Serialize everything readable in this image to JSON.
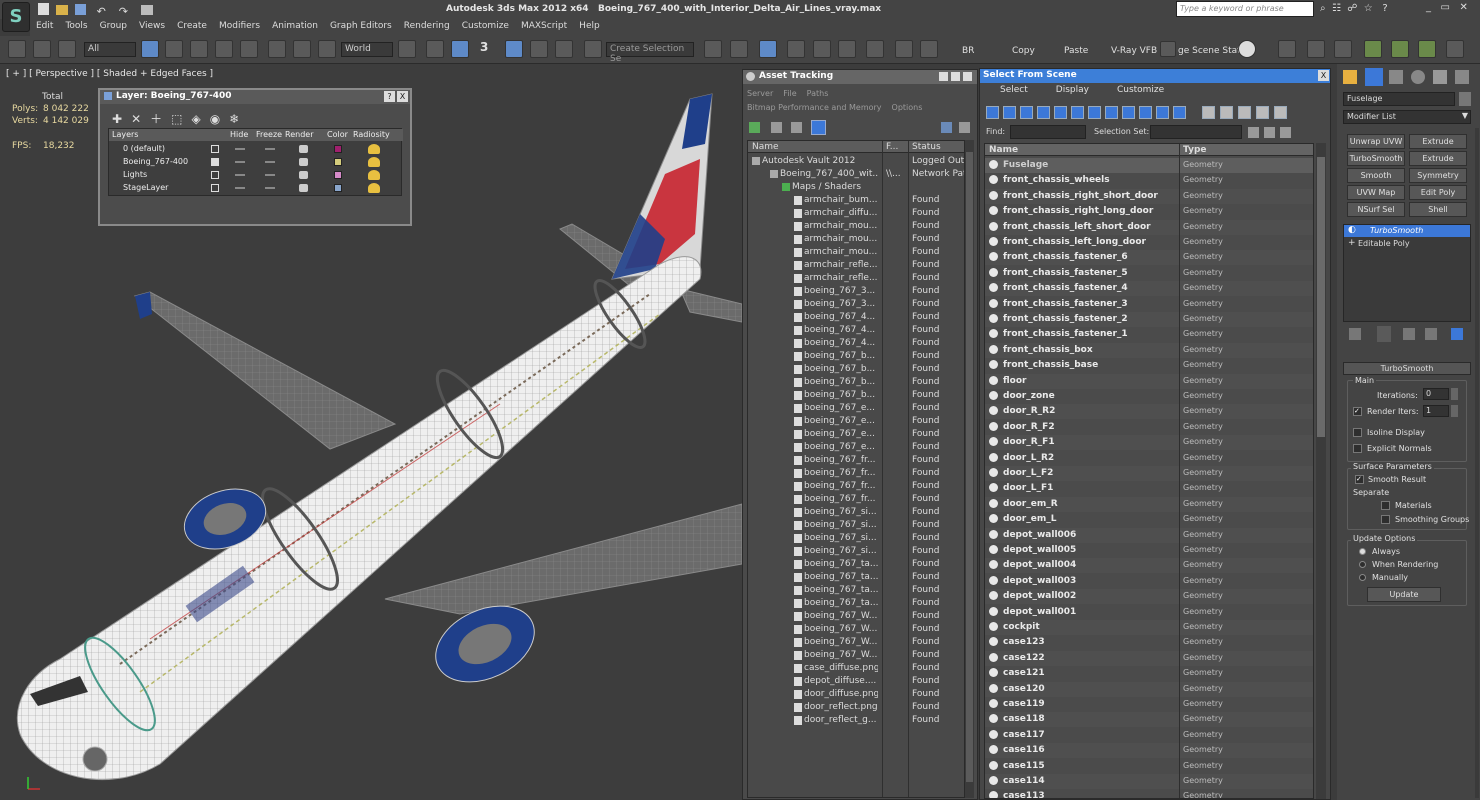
{
  "window": {
    "app_title": "Autodesk 3ds Max  2012 x64",
    "file_title": "Boeing_767_400_with_Interior_Delta_Air_Lines_vray.max",
    "search_placeholder": "Type a keyword or phrase",
    "app_icon_letter": "S"
  },
  "menu": [
    "Edit",
    "Tools",
    "Group",
    "Views",
    "Create",
    "Modifiers",
    "Animation",
    "Graph Editors",
    "Rendering",
    "Customize",
    "MAXScript",
    "Help"
  ],
  "toolbar": {
    "filter": "All",
    "coord": "World",
    "snap_num": "3",
    "selection_set_placeholder": "Create Selection Se",
    "render_buttons": [
      "BR",
      "Copy",
      "Paste",
      "V-Ray VFB",
      "ge Scene Stat"
    ]
  },
  "viewport": {
    "label": "[ + ] [ Perspective ] [ Shaded + Edged Faces ]",
    "stats": {
      "total_label": "Total",
      "polys_label": "Polys:",
      "polys": "8 042 222",
      "verts_label": "Verts:",
      "verts": "4 142 029",
      "fps_label": "FPS:",
      "fps": "18,232"
    }
  },
  "layer_dialog": {
    "title": "Layer: Boeing_767-400",
    "help": "?",
    "close": "X",
    "columns": [
      "Layers",
      "Hide",
      "Freeze",
      "Render",
      "Color",
      "Radiosity"
    ],
    "rows": [
      {
        "name": "0 (default)",
        "color": "#a0206e"
      },
      {
        "name": "Boeing_767-400",
        "color": "#d4cc7c"
      },
      {
        "name": "Lights",
        "color": "#d58ac8"
      },
      {
        "name": "StageLayer",
        "color": "#8aa6cc"
      }
    ]
  },
  "asset_tracking": {
    "title": "Asset Tracking",
    "menu": [
      "Server",
      "File",
      "Paths",
      "Bitmap Performance and Memory",
      "Options"
    ],
    "columns": [
      "Name",
      "F...",
      "Status"
    ],
    "rows": [
      {
        "name": "Autodesk Vault 2012",
        "f": "",
        "status": "Logged Out (..."
      },
      {
        "name": "Boeing_767_400_wit...",
        "f": "\\\\...",
        "status": "Network Path"
      },
      {
        "name": "Maps / Shaders",
        "f": "",
        "status": ""
      },
      {
        "name": "armchair_bum...",
        "f": "",
        "status": "Found"
      },
      {
        "name": "armchair_diffu...",
        "f": "",
        "status": "Found"
      },
      {
        "name": "armchair_mou...",
        "f": "",
        "status": "Found"
      },
      {
        "name": "armchair_mou...",
        "f": "",
        "status": "Found"
      },
      {
        "name": "armchair_mou...",
        "f": "",
        "status": "Found"
      },
      {
        "name": "armchair_refle...",
        "f": "",
        "status": "Found"
      },
      {
        "name": "armchair_refle...",
        "f": "",
        "status": "Found"
      },
      {
        "name": "boeing_767_3...",
        "f": "",
        "status": "Found"
      },
      {
        "name": "boeing_767_3...",
        "f": "",
        "status": "Found"
      },
      {
        "name": "boeing_767_4...",
        "f": "",
        "status": "Found"
      },
      {
        "name": "boeing_767_4...",
        "f": "",
        "status": "Found"
      },
      {
        "name": "boeing_767_4...",
        "f": "",
        "status": "Found"
      },
      {
        "name": "boeing_767_b...",
        "f": "",
        "status": "Found"
      },
      {
        "name": "boeing_767_b...",
        "f": "",
        "status": "Found"
      },
      {
        "name": "boeing_767_b...",
        "f": "",
        "status": "Found"
      },
      {
        "name": "boeing_767_b...",
        "f": "",
        "status": "Found"
      },
      {
        "name": "boeing_767_e...",
        "f": "",
        "status": "Found"
      },
      {
        "name": "boeing_767_e...",
        "f": "",
        "status": "Found"
      },
      {
        "name": "boeing_767_e...",
        "f": "",
        "status": "Found"
      },
      {
        "name": "boeing_767_e...",
        "f": "",
        "status": "Found"
      },
      {
        "name": "boeing_767_fr...",
        "f": "",
        "status": "Found"
      },
      {
        "name": "boeing_767_fr...",
        "f": "",
        "status": "Found"
      },
      {
        "name": "boeing_767_fr...",
        "f": "",
        "status": "Found"
      },
      {
        "name": "boeing_767_fr...",
        "f": "",
        "status": "Found"
      },
      {
        "name": "boeing_767_si...",
        "f": "",
        "status": "Found"
      },
      {
        "name": "boeing_767_si...",
        "f": "",
        "status": "Found"
      },
      {
        "name": "boeing_767_si...",
        "f": "",
        "status": "Found"
      },
      {
        "name": "boeing_767_si...",
        "f": "",
        "status": "Found"
      },
      {
        "name": "boeing_767_ta...",
        "f": "",
        "status": "Found"
      },
      {
        "name": "boeing_767_ta...",
        "f": "",
        "status": "Found"
      },
      {
        "name": "boeing_767_ta...",
        "f": "",
        "status": "Found"
      },
      {
        "name": "boeing_767_ta...",
        "f": "",
        "status": "Found"
      },
      {
        "name": "boeing_767_W...",
        "f": "",
        "status": "Found"
      },
      {
        "name": "boeing_767_W...",
        "f": "",
        "status": "Found"
      },
      {
        "name": "boeing_767_W...",
        "f": "",
        "status": "Found"
      },
      {
        "name": "boeing_767_W...",
        "f": "",
        "status": "Found"
      },
      {
        "name": "case_diffuse.png",
        "f": "",
        "status": "Found"
      },
      {
        "name": "depot_diffuse....",
        "f": "",
        "status": "Found"
      },
      {
        "name": "door_diffuse.png",
        "f": "",
        "status": "Found"
      },
      {
        "name": "door_reflect.png",
        "f": "",
        "status": "Found"
      },
      {
        "name": "door_reflect_g...",
        "f": "",
        "status": "Found"
      }
    ]
  },
  "select_from_scene": {
    "title": "Select From Scene",
    "close": "X",
    "menu": [
      "Select",
      "Display",
      "Customize"
    ],
    "find_label": "Find:",
    "selection_set_label": "Selection Set:",
    "columns": [
      "Name",
      "Type"
    ],
    "rows": [
      {
        "name": "Fuselage",
        "type": "Geometry",
        "selected": true
      },
      {
        "name": "front_chassis_wheels",
        "type": "Geometry"
      },
      {
        "name": "front_chassis_right_short_door",
        "type": "Geometry"
      },
      {
        "name": "front_chassis_right_long_door",
        "type": "Geometry"
      },
      {
        "name": "front_chassis_left_short_door",
        "type": "Geometry"
      },
      {
        "name": "front_chassis_left_long_door",
        "type": "Geometry"
      },
      {
        "name": "front_chassis_fastener_6",
        "type": "Geometry"
      },
      {
        "name": "front_chassis_fastener_5",
        "type": "Geometry"
      },
      {
        "name": "front_chassis_fastener_4",
        "type": "Geometry"
      },
      {
        "name": "front_chassis_fastener_3",
        "type": "Geometry"
      },
      {
        "name": "front_chassis_fastener_2",
        "type": "Geometry"
      },
      {
        "name": "front_chassis_fastener_1",
        "type": "Geometry"
      },
      {
        "name": "front_chassis_box",
        "type": "Geometry"
      },
      {
        "name": "front_chassis_base",
        "type": "Geometry"
      },
      {
        "name": "floor",
        "type": "Geometry"
      },
      {
        "name": "door_zone",
        "type": "Geometry"
      },
      {
        "name": "door_R_R2",
        "type": "Geometry"
      },
      {
        "name": "door_R_F2",
        "type": "Geometry"
      },
      {
        "name": "door_R_F1",
        "type": "Geometry"
      },
      {
        "name": "door_L_R2",
        "type": "Geometry"
      },
      {
        "name": "door_L_F2",
        "type": "Geometry"
      },
      {
        "name": "door_L_F1",
        "type": "Geometry"
      },
      {
        "name": "door_em_R",
        "type": "Geometry"
      },
      {
        "name": "door_em_L",
        "type": "Geometry"
      },
      {
        "name": "depot_wall006",
        "type": "Geometry"
      },
      {
        "name": "depot_wall005",
        "type": "Geometry"
      },
      {
        "name": "depot_wall004",
        "type": "Geometry"
      },
      {
        "name": "depot_wall003",
        "type": "Geometry"
      },
      {
        "name": "depot_wall002",
        "type": "Geometry"
      },
      {
        "name": "depot_wall001",
        "type": "Geometry"
      },
      {
        "name": "cockpit",
        "type": "Geometry"
      },
      {
        "name": "case123",
        "type": "Geometry"
      },
      {
        "name": "case122",
        "type": "Geometry"
      },
      {
        "name": "case121",
        "type": "Geometry"
      },
      {
        "name": "case120",
        "type": "Geometry"
      },
      {
        "name": "case119",
        "type": "Geometry"
      },
      {
        "name": "case118",
        "type": "Geometry"
      },
      {
        "name": "case117",
        "type": "Geometry"
      },
      {
        "name": "case116",
        "type": "Geometry"
      },
      {
        "name": "case115",
        "type": "Geometry"
      },
      {
        "name": "case114",
        "type": "Geometry"
      },
      {
        "name": "case113",
        "type": "Geometry"
      }
    ]
  },
  "command_panel": {
    "object_name": "Fuselage",
    "modifier_list": "Modifier List",
    "buttons": [
      "Unwrap UVW",
      "Extrude",
      "TurboSmooth",
      "Extrude",
      "Smooth",
      "Symmetry",
      "UVW Map",
      "Edit Poly",
      "NSurf Sel",
      "Shell"
    ],
    "stack": [
      "TurboSmooth",
      "Editable Poly"
    ],
    "rollout_title": "TurboSmooth",
    "main_label": "Main",
    "iterations_label": "Iterations:",
    "iterations": "0",
    "render_iters_label": "Render Iters:",
    "render_iters": "1",
    "isoline_label": "Isoline Display",
    "explicit_normals_label": "Explicit Normals",
    "surface_params_label": "Surface Parameters",
    "smooth_result_label": "Smooth Result",
    "separate_label": "Separate",
    "materials_label": "Materials",
    "smoothing_groups_label": "Smoothing Groups",
    "update_options_label": "Update Options",
    "always_label": "Always",
    "when_rendering_label": "When Rendering",
    "manually_label": "Manually",
    "update_button": "Update"
  },
  "colors": {
    "accent": "#3c78d8",
    "delta_red": "#c8242f",
    "delta_blue": "#1f3f8a",
    "selection_bar": "#5b5b5b"
  }
}
